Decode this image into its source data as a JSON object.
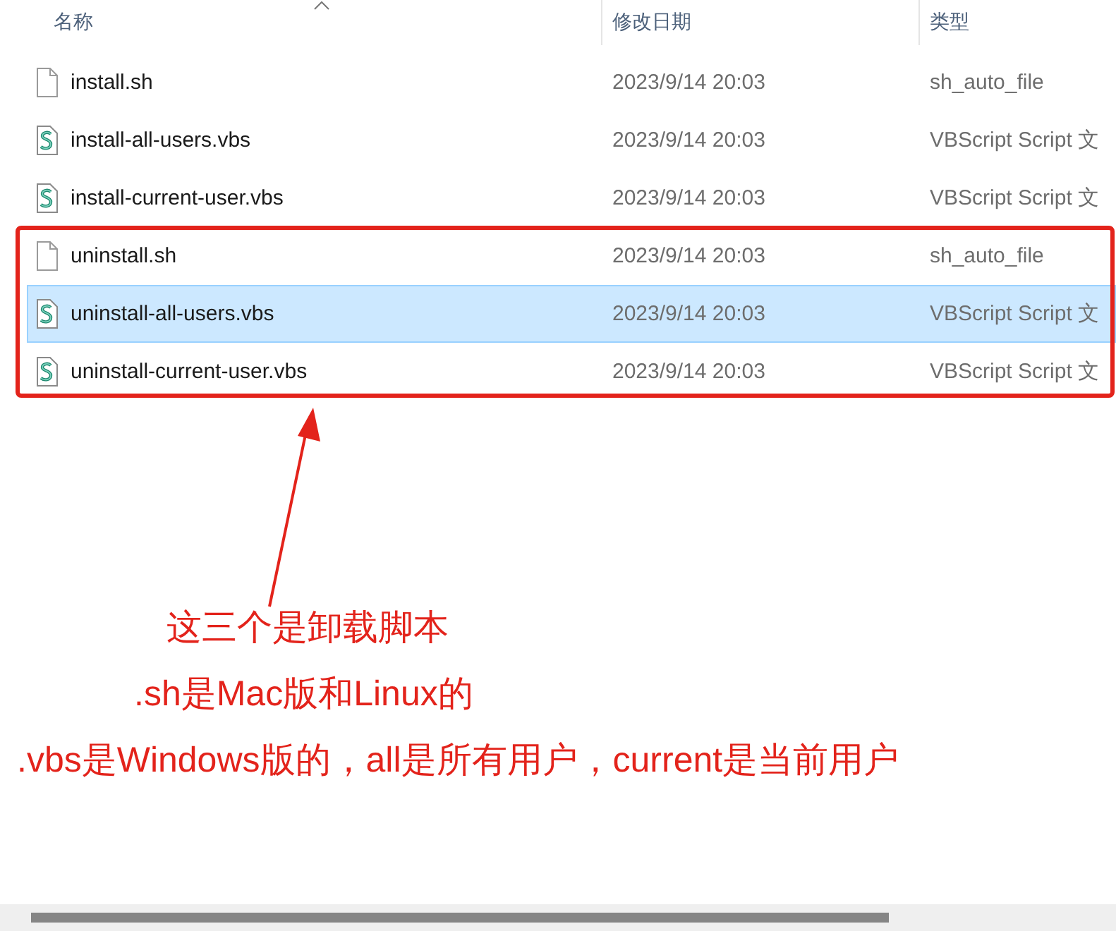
{
  "columns": [
    {
      "label": "名称",
      "sorted": true
    },
    {
      "label": "修改日期",
      "sorted": false
    },
    {
      "label": "类型",
      "sorted": false
    }
  ],
  "files": [
    {
      "name": "install.sh",
      "modified": "2023/9/14 20:03",
      "type": "sh_auto_file",
      "kind": "plain",
      "selected": false
    },
    {
      "name": "install-all-users.vbs",
      "modified": "2023/9/14 20:03",
      "type": "VBScript Script 文",
      "kind": "script",
      "selected": false
    },
    {
      "name": "install-current-user.vbs",
      "modified": "2023/9/14 20:03",
      "type": "VBScript Script 文",
      "kind": "script",
      "selected": false
    },
    {
      "name": "uninstall.sh",
      "modified": "2023/9/14 20:03",
      "type": "sh_auto_file",
      "kind": "plain",
      "selected": false
    },
    {
      "name": "uninstall-all-users.vbs",
      "modified": "2023/9/14 20:03",
      "type": "VBScript Script 文",
      "kind": "script",
      "selected": true
    },
    {
      "name": "uninstall-current-user.vbs",
      "modified": "2023/9/14 20:03",
      "type": "VBScript Script 文",
      "kind": "script",
      "selected": false
    }
  ],
  "annotation": {
    "notes": [
      "这三个是卸载脚本",
      ".sh是Mac版和Linux的",
      ".vbs是Windows版的，all是所有用户，current是当前用户"
    ]
  }
}
